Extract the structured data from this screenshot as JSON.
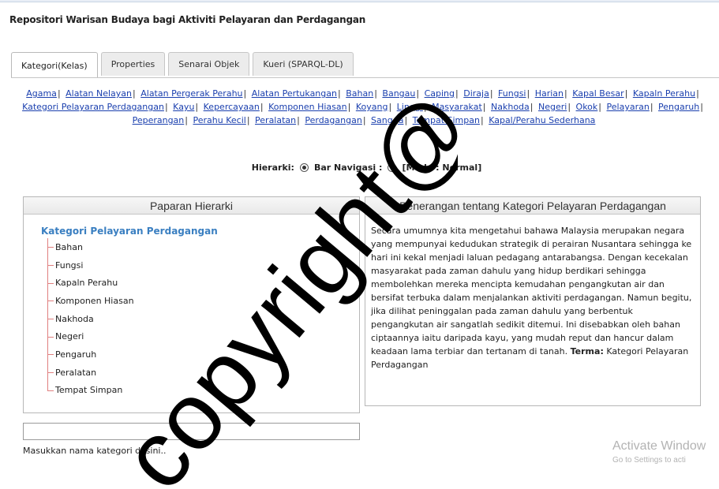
{
  "app_title": "Repositori Warisan Budaya bagi Aktiviti Pelayaran dan Perdagangan",
  "tabs": [
    {
      "label": "Kategori(Kelas)",
      "active": true
    },
    {
      "label": "Properties",
      "active": false
    },
    {
      "label": "Senarai Objek",
      "active": false
    },
    {
      "label": "Kueri (SPARQL-DL)",
      "active": false
    }
  ],
  "category_links": [
    "Agama",
    "Alatan Nelayan",
    "Alatan Pergerak Perahu",
    "Alatan Pertukangan",
    "Bahan",
    "Bangau",
    "Caping",
    "Diraja",
    "Fungsi",
    "Harian",
    "Kapal Besar",
    "Kapaln Perahu",
    "Kategori Pelayaran Perdagangan",
    "Kayu",
    "Kepercayaan",
    "Komponen Hiasan",
    "Koyang",
    "Linggi",
    "Masyarakat",
    "Nakhoda",
    "Negeri",
    "Okok",
    "Pelayaran",
    "Pengaruh",
    "Peperangan",
    "Perahu Kecil",
    "Peralatan",
    "Perdagangan",
    "Sangga",
    "Tempat Simpan",
    "Kapal/Perahu Sederhana"
  ],
  "link_separator": "|",
  "hierarki": {
    "label": "Hierarki:",
    "option1": "Bar Navigasi :",
    "option2": "[Mode : Normal]"
  },
  "left_panel": {
    "title": "Paparan Hierarki",
    "root": "Kategori Pelayaran Perdagangan",
    "items": [
      "Bahan",
      "Fungsi",
      "Kapaln Perahu",
      "Komponen Hiasan",
      "Nakhoda",
      "Negeri",
      "Pengaruh",
      "Peralatan",
      "Tempat Simpan"
    ]
  },
  "right_panel": {
    "title": "Penerangan tentang Kategori Pelayaran Perdagangan",
    "description": "Secara umumnya kita mengetahui bahawa Malaysia merupakan negara yang mempunyai kedudukan strategik di perairan Nusantara sehingga ke hari ini kekal menjadi laluan pedagang antarabangsa. Dengan kecekalan masyarakat pada zaman dahulu yang hidup berdikari sehingga membolehkan mereka mencipta kemudahan pengangkutan air dan bersifat terbuka dalam menjalankan aktiviti perdagangan. Namun begitu, jika dilihat peninggalan pada zaman dahulu yang berbentuk pengangkutan air sangatlah sedikit ditemui. Ini disebabkan oleh bahan ciptaannya iaitu daripada kayu, yang mudah reput dan hancur dalam keadaan lama terbiar dan tertanam di tanah.",
    "term_label": "Terma:",
    "term_value": "Kategori Pelayaran Perdagangan"
  },
  "input": {
    "value": ""
  },
  "hint": "Masukkan nama kategori di sini..",
  "watermark": {
    "line1": "Activate Window",
    "line2": "Go to Settings to acti"
  },
  "overlay": {
    "text": "copyright@",
    "color": "#000000"
  }
}
